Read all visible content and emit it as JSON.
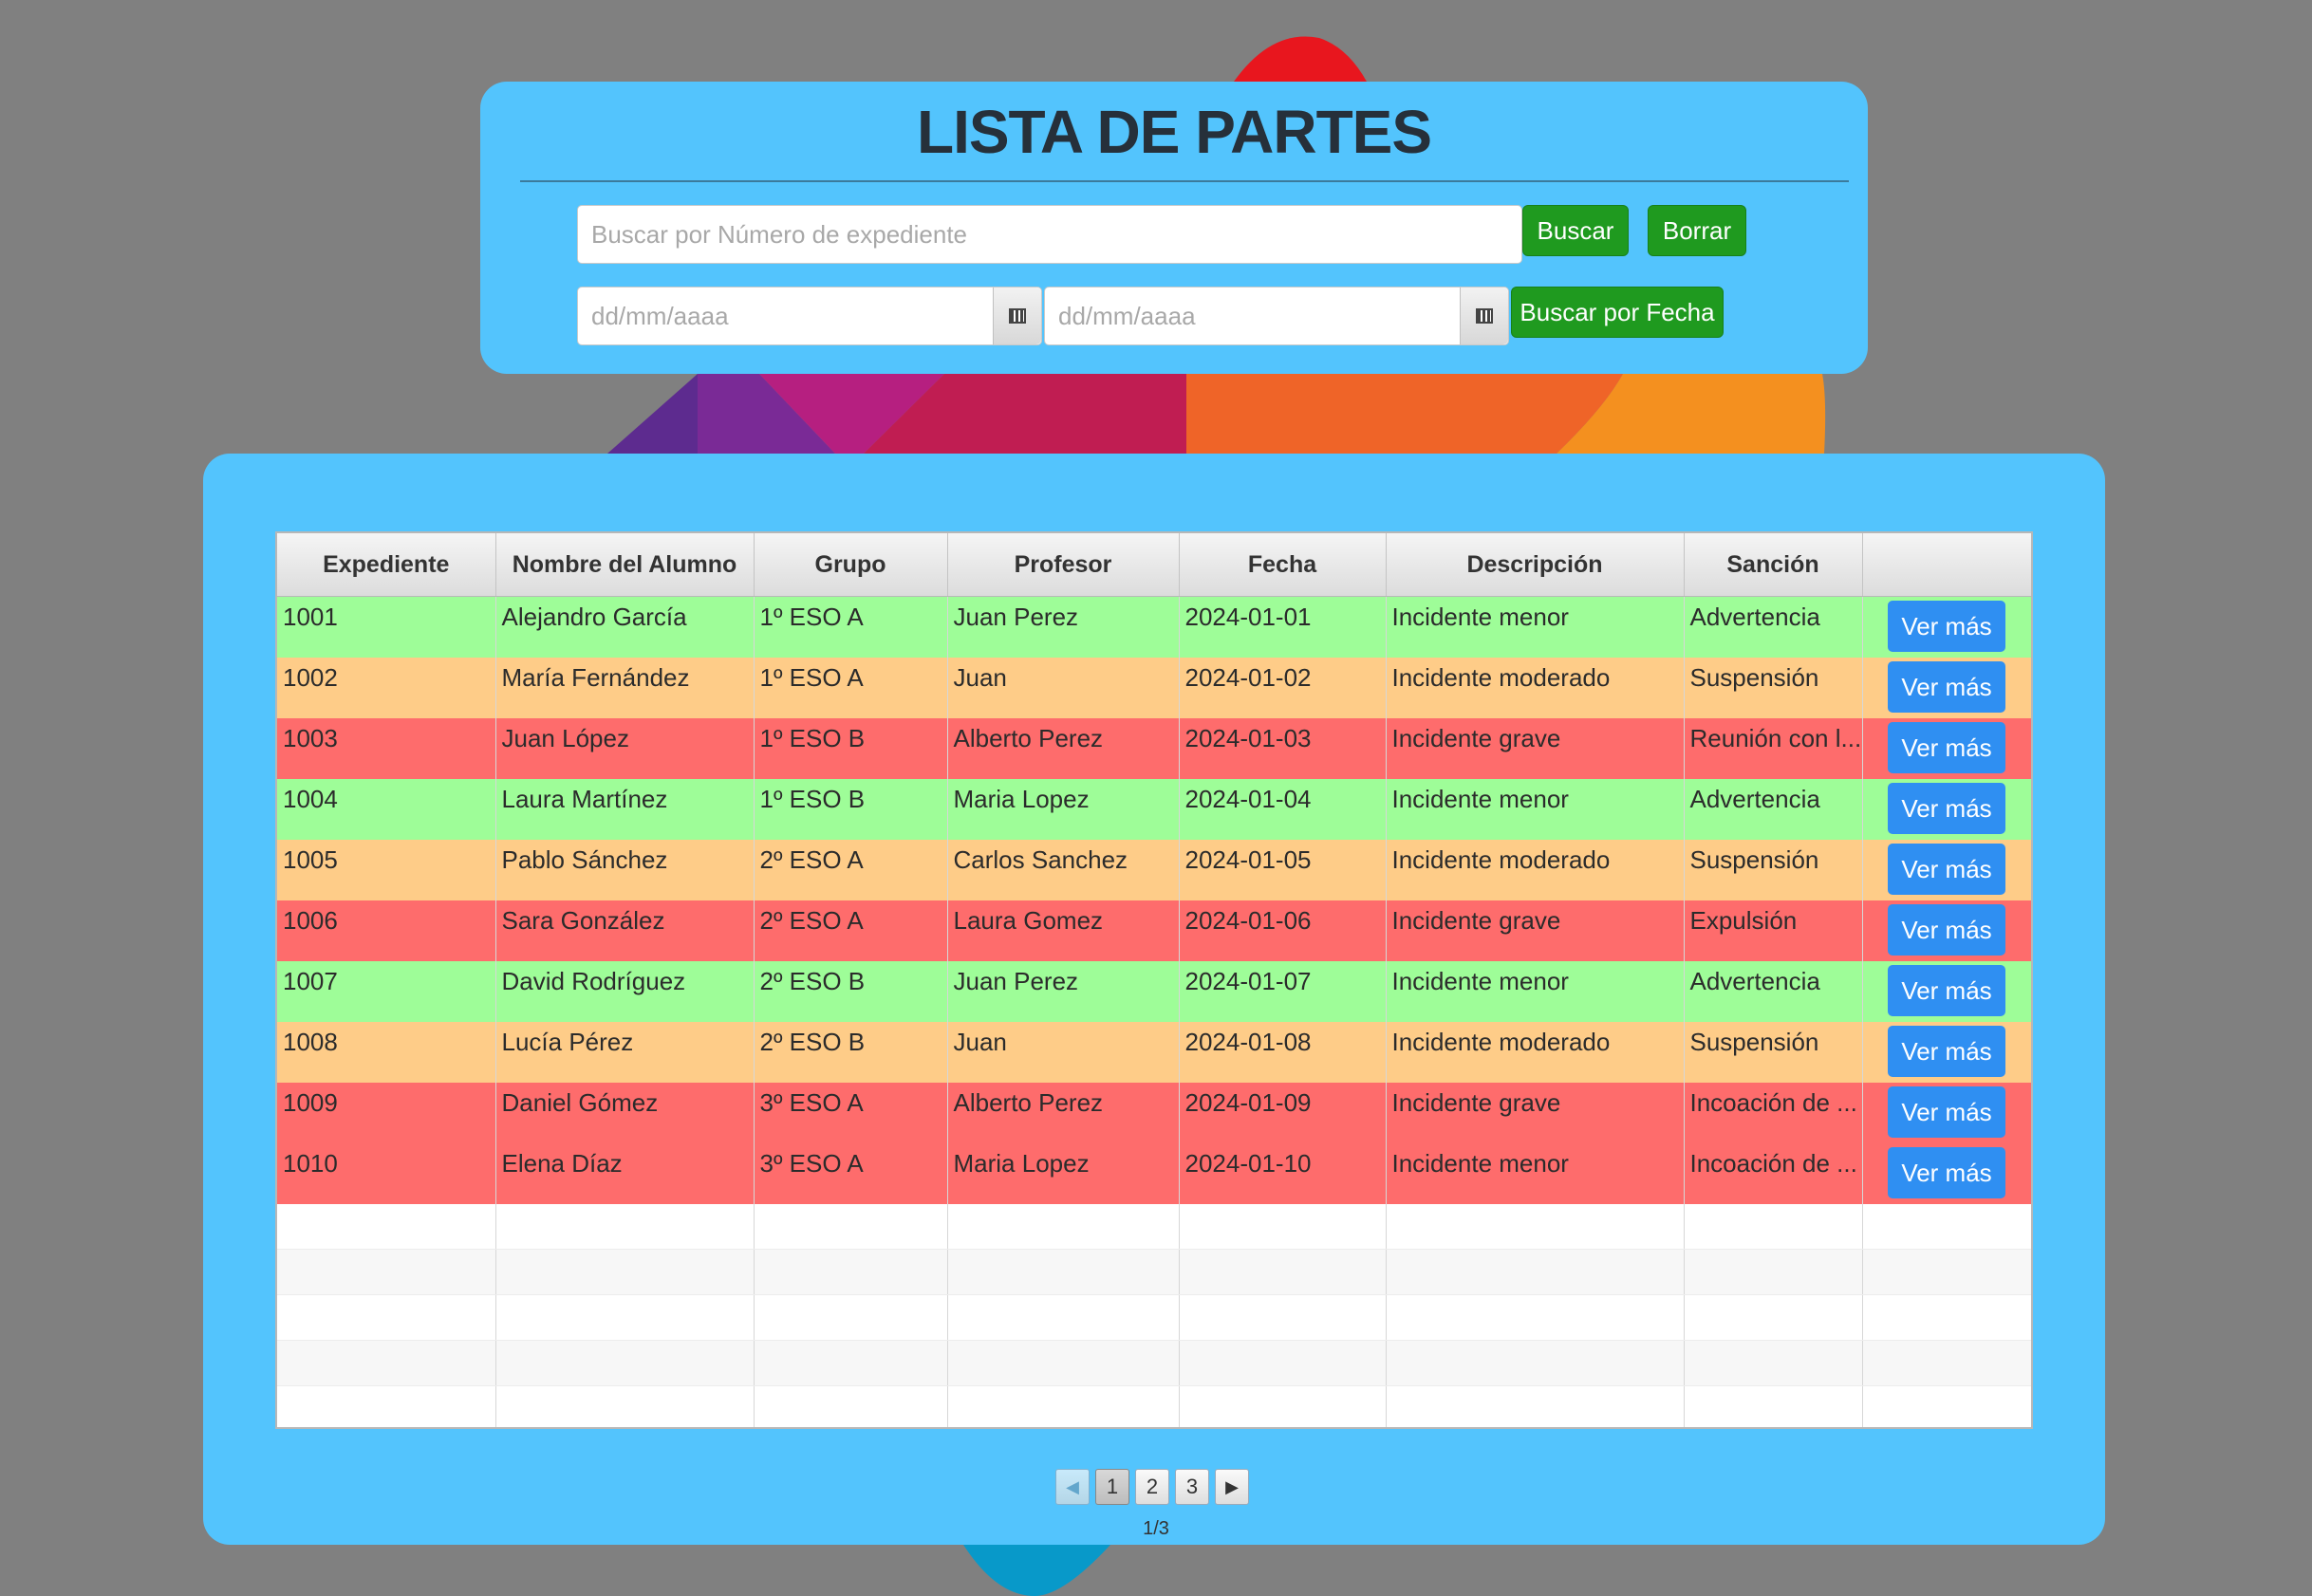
{
  "header": {
    "title": "LISTA DE PARTES",
    "search_placeholder": "Buscar por Número de expediente",
    "search_label": "Buscar",
    "clear_label": "Borrar",
    "date_from_placeholder": "dd/mm/aaaa",
    "date_to_placeholder": "dd/mm/aaaa",
    "date_search_label": "Buscar por Fecha"
  },
  "table": {
    "columns": [
      "Expediente",
      "Nombre del Alumno",
      "Grupo",
      "Profesor",
      "Fecha",
      "Descripción",
      "Sanción",
      ""
    ],
    "rows": [
      {
        "expediente": "1001",
        "nombre": "Alejandro García",
        "grupo": "1º ESO A",
        "profesor": "Juan Perez",
        "fecha": "2024-01-01",
        "descripcion": "Incidente menor",
        "sancion": "Advertencia",
        "action": "Ver más",
        "severity": "green"
      },
      {
        "expediente": "1002",
        "nombre": "María Fernández",
        "grupo": "1º ESO A",
        "profesor": "Juan",
        "fecha": "2024-01-02",
        "descripcion": "Incidente moderado",
        "sancion": "Suspensión",
        "action": "Ver más",
        "severity": "orange"
      },
      {
        "expediente": "1003",
        "nombre": "Juan López",
        "grupo": "1º ESO B",
        "profesor": "Alberto Perez",
        "fecha": "2024-01-03",
        "descripcion": "Incidente grave",
        "sancion": "Reunión con l...",
        "action": "Ver más",
        "severity": "red"
      },
      {
        "expediente": "1004",
        "nombre": "Laura Martínez",
        "grupo": "1º ESO B",
        "profesor": "Maria Lopez",
        "fecha": "2024-01-04",
        "descripcion": "Incidente menor",
        "sancion": "Advertencia",
        "action": "Ver más",
        "severity": "green"
      },
      {
        "expediente": "1005",
        "nombre": "Pablo Sánchez",
        "grupo": "2º ESO A",
        "profesor": "Carlos Sanchez",
        "fecha": "2024-01-05",
        "descripcion": "Incidente moderado",
        "sancion": "Suspensión",
        "action": "Ver más",
        "severity": "orange"
      },
      {
        "expediente": "1006",
        "nombre": "Sara González",
        "grupo": "2º ESO A",
        "profesor": "Laura Gomez",
        "fecha": "2024-01-06",
        "descripcion": "Incidente grave",
        "sancion": "Expulsión",
        "action": "Ver más",
        "severity": "red"
      },
      {
        "expediente": "1007",
        "nombre": "David Rodríguez",
        "grupo": "2º ESO B",
        "profesor": "Juan Perez",
        "fecha": "2024-01-07",
        "descripcion": "Incidente menor",
        "sancion": "Advertencia",
        "action": "Ver más",
        "severity": "green"
      },
      {
        "expediente": "1008",
        "nombre": "Lucía Pérez",
        "grupo": "2º ESO B",
        "profesor": "Juan",
        "fecha": "2024-01-08",
        "descripcion": "Incidente moderado",
        "sancion": "Suspensión",
        "action": "Ver más",
        "severity": "orange"
      },
      {
        "expediente": "1009",
        "nombre": "Daniel Gómez",
        "grupo": "3º ESO A",
        "profesor": "Alberto Perez",
        "fecha": "2024-01-09",
        "descripcion": "Incidente grave",
        "sancion": "Incoación de ...",
        "action": "Ver más",
        "severity": "red"
      },
      {
        "expediente": "1010",
        "nombre": "Elena Díaz",
        "grupo": "3º ESO A",
        "profesor": "Maria Lopez",
        "fecha": "2024-01-10",
        "descripcion": "Incidente menor",
        "sancion": "Incoación de ...",
        "action": "Ver más",
        "severity": "red"
      }
    ]
  },
  "pagination": {
    "pages": [
      "1",
      "2",
      "3"
    ],
    "current": "1",
    "status": "1/3"
  },
  "colors": {
    "panel": "#53c4fd",
    "button_green": "#1f9a1f",
    "button_blue": "#2f8ff2",
    "row_green": "#9efd98",
    "row_orange": "#fecc88",
    "row_red": "#fe6c6c"
  },
  "icons": {
    "calendar": "calendar-icon",
    "prev": "chevron-left-icon",
    "next": "chevron-right-icon"
  }
}
